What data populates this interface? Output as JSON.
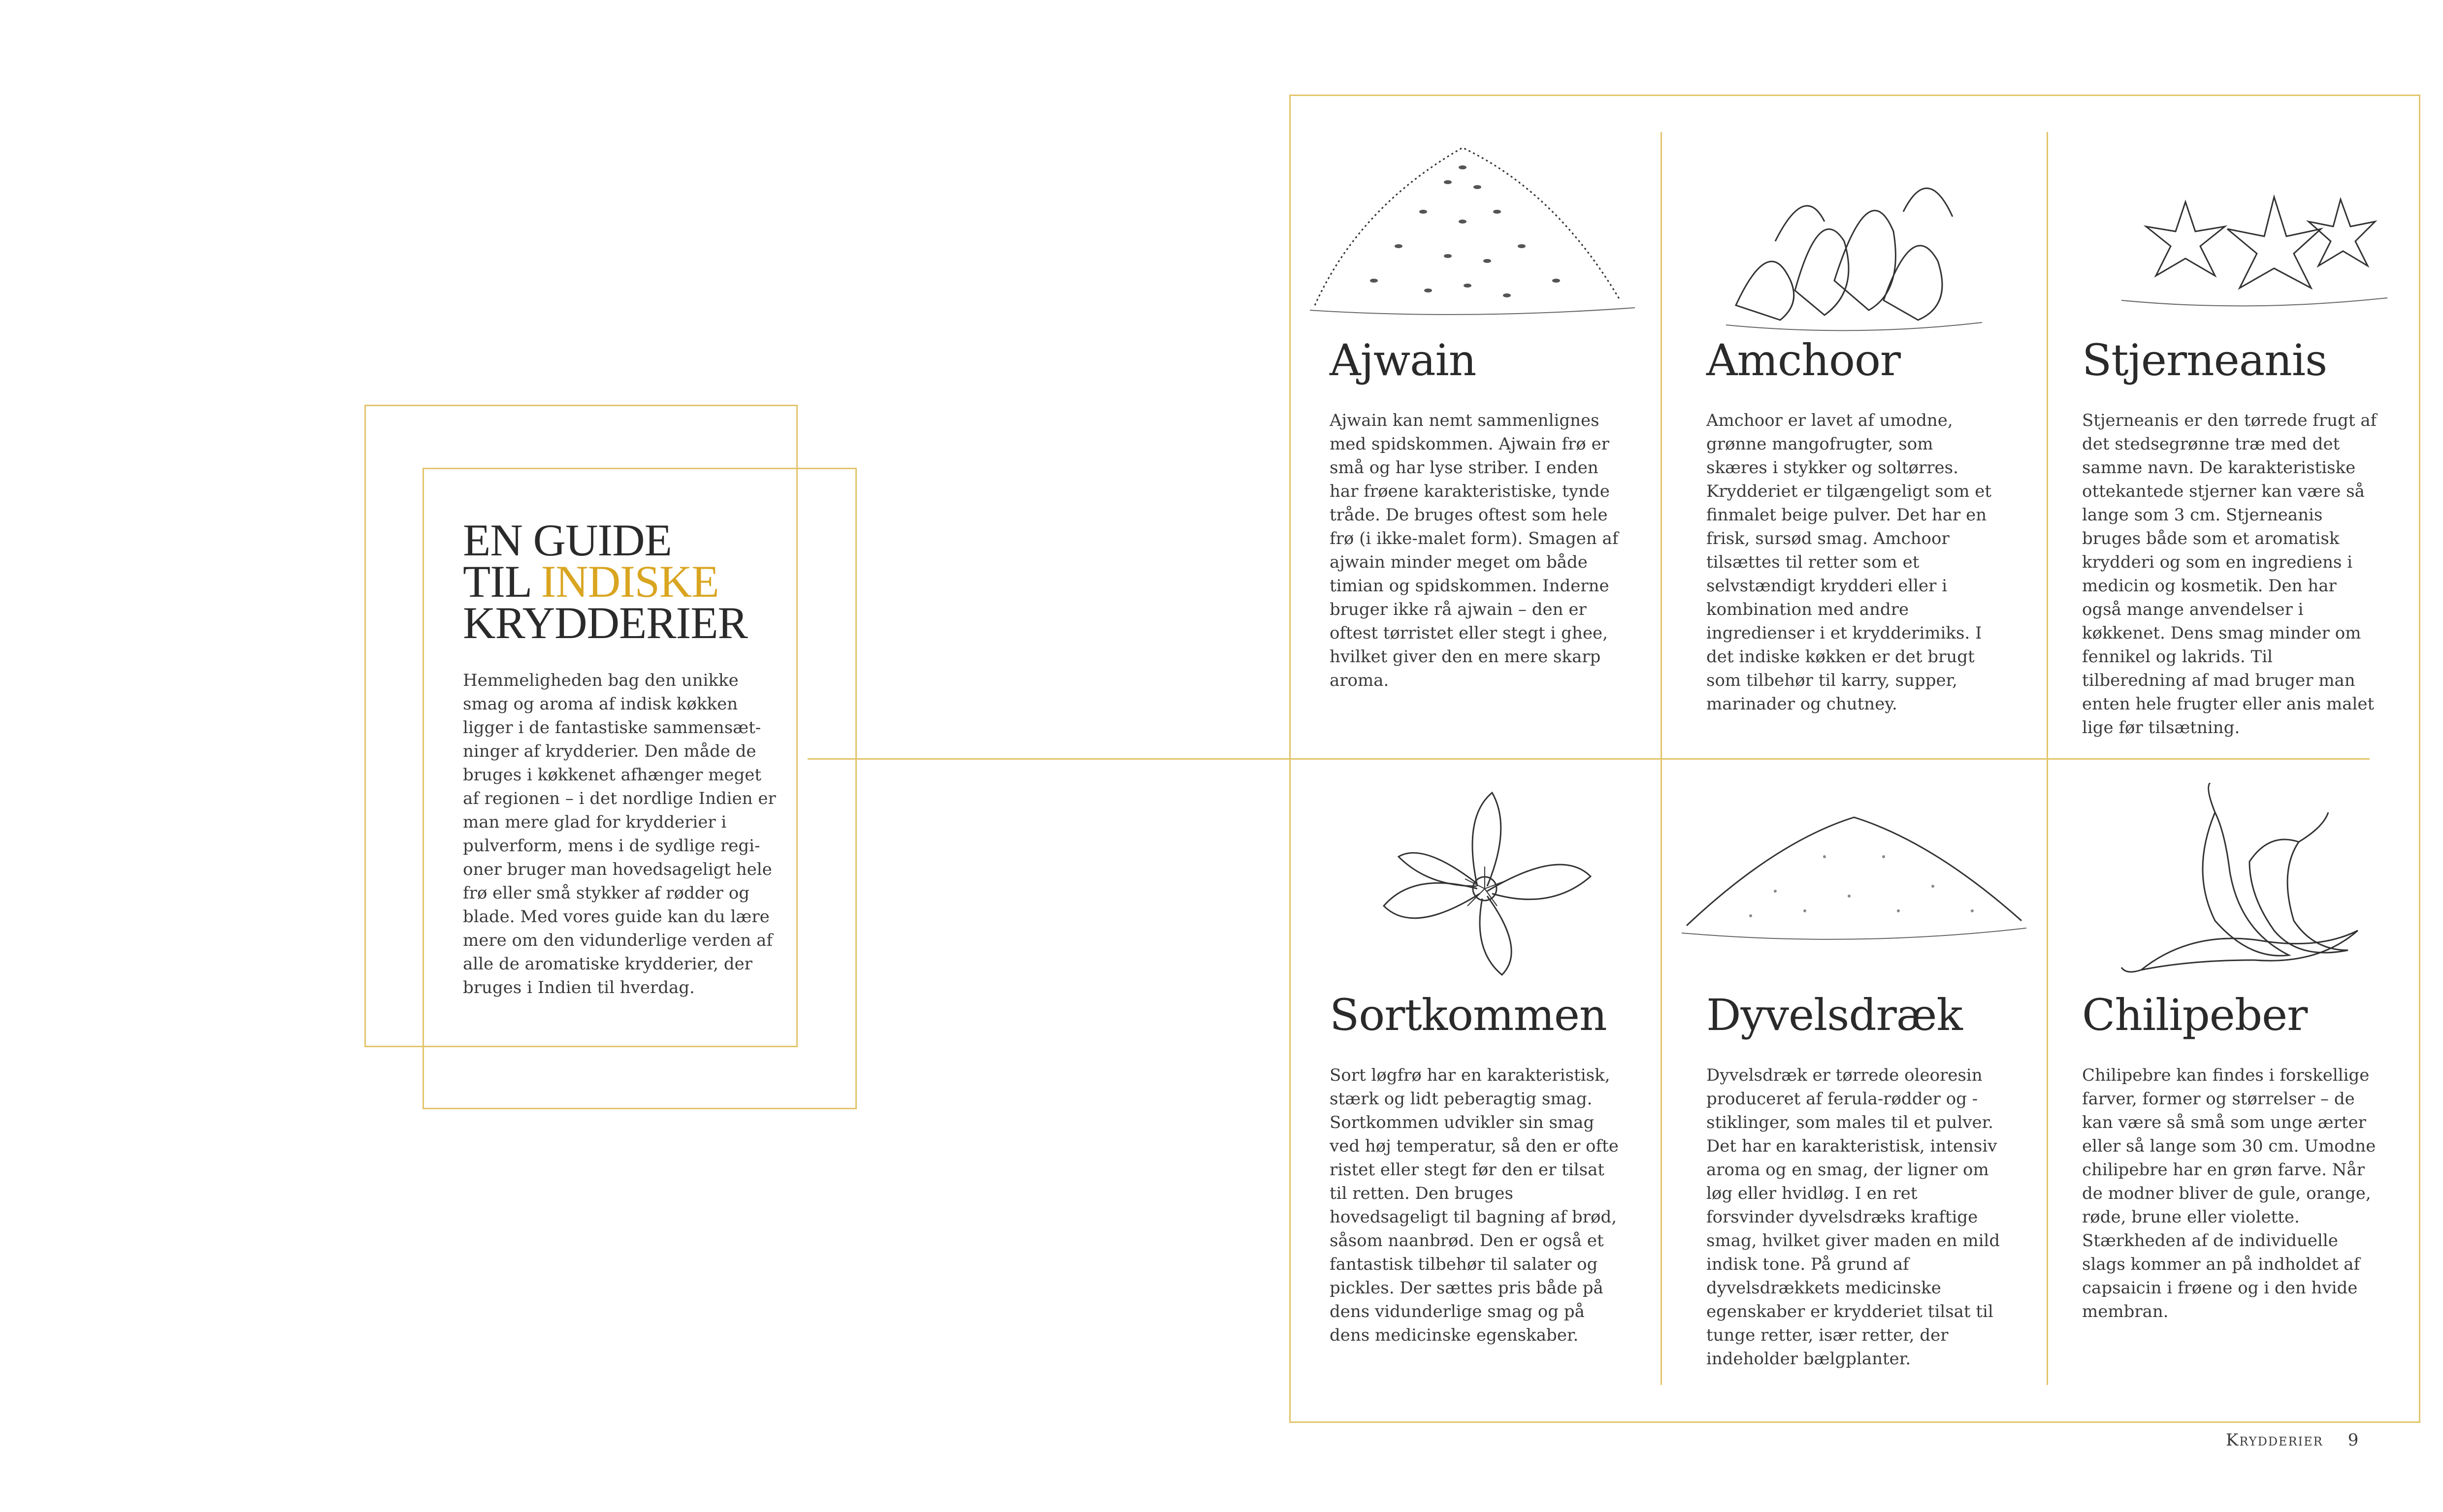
{
  "intro": {
    "title_line1": "EN GUIDE",
    "title_line2_prefix": "TIL ",
    "title_line2_highlight": "INDISKE",
    "title_line3": "KRYDDERIER",
    "body": "Hemmeligheden bag den unikke smag og aroma af indisk køkken ligger i de fantastiske sammensæt-ninger af krydderier. Den måde de bruges i køkkenet afhænger meget af regionen – i det nordlige Indien er man mere glad for krydderier i pulverform, mens i de sydlige regi-oner bruger man hovedsageligt hele frø eller små stykker af rødder og blade. Med vores guide kan du lære mere om den vidunderlige verden af alle de aromatiske krydderier, der bruges i Indien til hverdag."
  },
  "spices": [
    {
      "name": "Ajwain",
      "icon": "ajwain-seeds-illustration",
      "text": "Ajwain kan nemt sammenlignes med spidskommen. Ajwain frø er små og har lyse striber. I enden har frøene karakteristiske, tynde tråde. De bruges oftest som hele frø (i ikke-malet form). Smagen af ajwain minder meget om både timian og spidskommen. Inderne bruger ikke rå ajwain – den er oftest tørristet eller stegt i ghee, hvilket giver den en mere skarp aroma."
    },
    {
      "name": "Amchoor",
      "icon": "amchoor-slices-illustration",
      "text": "Amchoor er lavet af umodne, grønne mangofrugter, som skæres i stykker og soltørres. Krydderiet er tilgængeligt som et finmalet beige pulver. Det har en frisk, sursød smag. Amchoor tilsættes til retter som et selvstændigt krydderi eller i kombination med andre ingredienser i et krydderimiks. I det indiske køkken er det brugt som tilbehør til karry, supper, marinader og chutney."
    },
    {
      "name": "Stjerneanis",
      "icon": "star-anise-illustration",
      "text": "Stjerneanis er den tørrede frugt af det stedsegrønne træ med det samme navn. De karakteristiske ottekantede stjerner kan være så lange som 3 cm. Stjerneanis bruges både som et aromatisk krydderi og som en ingrediens i medicin og kosmetik. Den har også mange anvendelser i køkkenet. Dens smag minder om fennikel og lakrids. Til tilberedning af mad bruger man enten hele frugter eller anis malet lige før tilsætning."
    },
    {
      "name": "Sortkommen",
      "icon": "nigella-flower-illustration",
      "text": "Sort løgfrø har en karakteristisk, stærk og lidt peberagtig smag. Sortkommen udvikler sin smag ved høj temperatur, så den er ofte ristet eller stegt før den er tilsat til retten. Den bruges hovedsageligt til bagning af brød, såsom naanbrød. Den er også et fantastisk tilbehør til salater og pickles. Der sættes pris både på dens vidunderlige smag og på dens medicinske egenskaber."
    },
    {
      "name": "Dyvelsdræk",
      "icon": "asafoetida-powder-illustration",
      "text": "Dyvelsdræk er tørrede oleoresin produceret af ferula-rødder og -stiklinger, som males til et pulver. Det har en karakteristisk, intensiv aroma og en smag, der ligner om løg eller hvidløg. I en ret forsvinder dyvelsdræks kraftige smag, hvilket giver maden en mild indisk tone. På grund af dyvelsdrækkets medicinske egenskaber er krydderiet tilsat til tunge retter, især retter, der indeholder bælgplanter."
    },
    {
      "name": "Chilipeber",
      "icon": "chili-peppers-illustration",
      "text": "Chilipebre kan findes i forskellige farver, former og størrelser – de kan være så små som unge ærter eller så lange som 30 cm. Umodne chilipebre har en grøn farve. Når de modner bliver de gule, orange, røde, brune eller violette. Stærkheden af de individuelle slags kommer an på indholdet af capsaicin i frøene og i den hvide membran."
    }
  ],
  "footer": {
    "section": "Krydderier",
    "page": "9"
  },
  "colors": {
    "accent": "#d9a520",
    "frame": "#e2c46a",
    "text": "#2a2a2a"
  }
}
